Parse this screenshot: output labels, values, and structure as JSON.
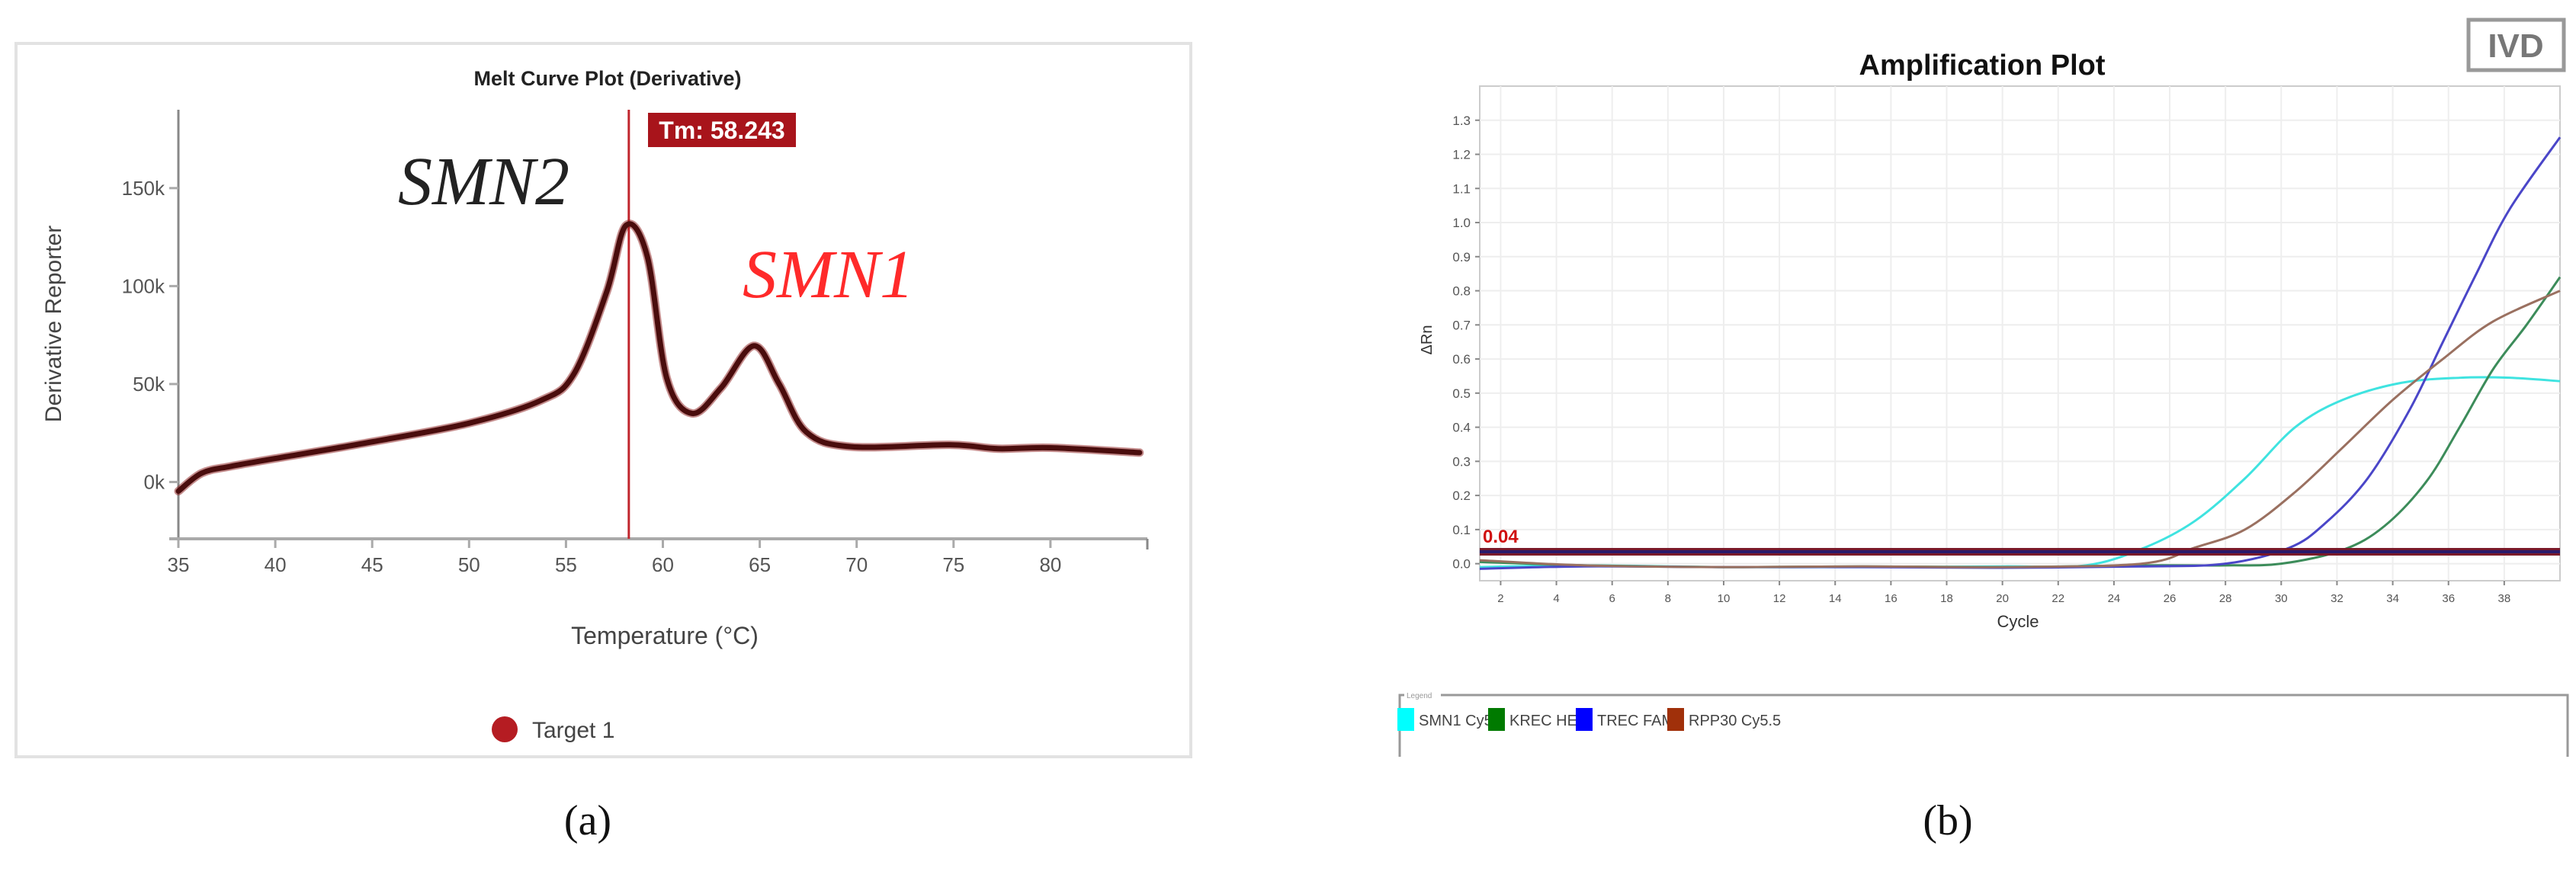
{
  "chart_data": [
    {
      "panel_label": "(a)",
      "type": "line",
      "title": "Melt Curve Plot (Derivative)",
      "xlabel": "Temperature (°C)",
      "ylabel": "Derivative Reporter",
      "xlim": [
        35,
        85
      ],
      "ylim": [
        -29000,
        190000
      ],
      "xticks": [
        35,
        40,
        45,
        50,
        55,
        60,
        65,
        70,
        75,
        80
      ],
      "xtick_labels": [
        "35",
        "40",
        "45",
        "50",
        "55",
        "60",
        "65",
        "70",
        "75",
        "80"
      ],
      "yticks": [
        0,
        50000,
        100000,
        150000
      ],
      "ytick_labels": [
        "0k",
        "50k",
        "100k",
        "150k"
      ],
      "grid": false,
      "marker_line": {
        "x": 58.243,
        "label": "Tm: 58.243",
        "color": "#c0262d"
      },
      "annotations": [
        {
          "text": "SMN2",
          "color": "#222222"
        },
        {
          "text": "SMN1",
          "color": "#ff2a2a"
        }
      ],
      "legend": {
        "placement": "bottom-center",
        "entries": [
          {
            "name": "Target 1",
            "color": "#b51c22"
          }
        ]
      },
      "series": [
        {
          "name": "Target 1",
          "color": "#4a0d0d",
          "x": [
            35,
            36.2,
            37.7,
            40,
            45,
            50,
            53.7,
            55.4,
            57.1,
            58.1,
            59.2,
            60.2,
            61.5,
            63,
            64.7,
            66,
            67.4,
            69.7,
            74.8,
            77.3,
            80,
            84.6
          ],
          "y": [
            -4700,
            4500,
            8000,
            12000,
            20500,
            30000,
            41600,
            55000,
            97000,
            131000,
            115000,
            53000,
            35000,
            48000,
            69500,
            50000,
            25500,
            18000,
            19000,
            17000,
            17500,
            15000
          ]
        }
      ]
    },
    {
      "panel_label": "(b)",
      "type": "line",
      "title": "Amplification Plot",
      "badge": "IVD",
      "xlabel": "Cycle",
      "ylabel": "ΔRn",
      "xlim": [
        1.25,
        40
      ],
      "ylim": [
        -0.05,
        1.4
      ],
      "xticks": [
        2,
        4,
        6,
        8,
        10,
        12,
        14,
        16,
        18,
        20,
        22,
        24,
        26,
        28,
        30,
        32,
        34,
        36,
        38
      ],
      "xtick_labels": [
        "2",
        "4",
        "6",
        "8",
        "10",
        "12",
        "14",
        "16",
        "18",
        "20",
        "22",
        "24",
        "26",
        "28",
        "30",
        "32",
        "34",
        "36",
        "38"
      ],
      "yticks": [
        0,
        0.1,
        0.2,
        0.3,
        0.4,
        0.5,
        0.6,
        0.7,
        0.8,
        0.9,
        1.0,
        1.1,
        1.2,
        1.3
      ],
      "ytick_labels": [
        "0.0",
        "0.1",
        "0.2",
        "0.3",
        "0.4",
        "0.5",
        "0.6",
        "0.7",
        "0.8",
        "0.9",
        "1.0",
        "1.1",
        "1.2",
        "1.3"
      ],
      "grid": true,
      "threshold": {
        "value": 0.035,
        "label": "0.04",
        "color": "#5a1530"
      },
      "legend": {
        "title": "Legend",
        "placement": "bottom"
      },
      "series": [
        {
          "name": "SMN1 Cy5",
          "color": "#3fe3e0",
          "swatch": "#00ffff",
          "x": [
            1.25,
            5,
            10,
            15,
            20,
            23,
            25.1,
            26.9,
            28.7,
            30.5,
            32.2,
            34.3,
            36.4,
            38.2,
            40
          ],
          "y": [
            -0.01,
            -0.005,
            -0.01,
            -0.01,
            -0.008,
            -0.005,
            0.047,
            0.125,
            0.25,
            0.4,
            0.48,
            0.53,
            0.545,
            0.545,
            0.535
          ]
        },
        {
          "name": "KREC HEX",
          "color": "#3c8c5a",
          "swatch": "#007a00",
          "x": [
            1.25,
            5,
            10,
            15,
            20,
            25,
            28,
            30,
            32.2,
            33.7,
            35.2,
            36.4,
            37.6,
            38.8,
            40
          ],
          "y": [
            0.005,
            -0.005,
            -0.01,
            -0.008,
            -0.01,
            -0.005,
            -0.005,
            0.0,
            0.04,
            0.11,
            0.24,
            0.4,
            0.57,
            0.7,
            0.84
          ]
        },
        {
          "name": "TREC FAM",
          "color": "#4a46c8",
          "swatch": "#0000ff",
          "x": [
            1.25,
            5,
            10,
            15,
            20,
            25,
            28,
            30.3,
            31.6,
            33.1,
            34.6,
            35.8,
            37,
            38.2,
            40
          ],
          "y": [
            -0.015,
            -0.008,
            -0.01,
            -0.01,
            -0.012,
            -0.008,
            0.0,
            0.047,
            0.12,
            0.25,
            0.45,
            0.65,
            0.85,
            1.04,
            1.25
          ]
        },
        {
          "name": "RPP30 Cy5.5",
          "color": "#9a7060",
          "swatch": "#a0300a",
          "x": [
            1.25,
            5,
            10,
            15,
            20,
            25,
            26.9,
            28.7,
            30.5,
            32.2,
            34,
            35.8,
            37.6,
            40
          ],
          "y": [
            0.01,
            -0.005,
            -0.01,
            -0.008,
            -0.01,
            0.0,
            0.047,
            0.1,
            0.21,
            0.34,
            0.48,
            0.6,
            0.71,
            0.8
          ]
        }
      ]
    }
  ]
}
